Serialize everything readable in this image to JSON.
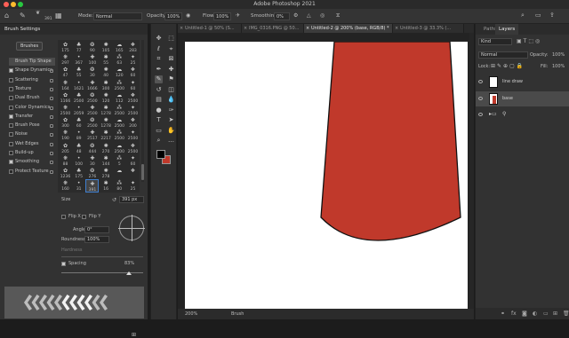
{
  "app": {
    "title": "Adobe Photoshop 2021"
  },
  "options_bar": {
    "size_value": "391",
    "mode_label": "Mode:",
    "mode_value": "Normal",
    "opacity_label": "Opacity:",
    "opacity_value": "100%",
    "flow_label": "Flow:",
    "flow_value": "100%",
    "smoothing_label": "Smoothing:",
    "smoothing_value": "0%"
  },
  "brush_panel": {
    "title": "Brush Settings",
    "brushes_button": "Brushes",
    "options": [
      {
        "label": "Brush Tip Shape",
        "checked": false,
        "selected": true,
        "lock": false
      },
      {
        "label": "Shape Dynamics",
        "checked": true,
        "lock": true
      },
      {
        "label": "Scattering",
        "checked": false,
        "lock": true
      },
      {
        "label": "Texture",
        "checked": false,
        "lock": true
      },
      {
        "label": "Dual Brush",
        "checked": false,
        "lock": true
      },
      {
        "label": "Color Dynamics",
        "checked": false,
        "lock": true
      },
      {
        "label": "Transfer",
        "checked": true,
        "lock": true
      },
      {
        "label": "Brush Pose",
        "checked": false,
        "lock": true
      },
      {
        "label": "Noise",
        "checked": false,
        "lock": true
      },
      {
        "label": "Wet Edges",
        "checked": false,
        "lock": true
      },
      {
        "label": "Build-up",
        "checked": false,
        "lock": true
      },
      {
        "label": "Smoothing",
        "checked": true,
        "lock": true
      },
      {
        "label": "Protect Texture",
        "checked": false,
        "lock": true
      }
    ],
    "tips": [
      "175",
      "77",
      "90",
      "105",
      "165",
      "283",
      "297",
      "367",
      "100",
      "55",
      "63",
      "25",
      "47",
      "55",
      "30",
      "40",
      "120",
      "60",
      "164",
      "1621",
      "1666",
      "300",
      "2500",
      "60",
      "1166",
      "2500",
      "2500",
      "120",
      "112",
      "2500",
      "2500",
      "2059",
      "2500",
      "1278",
      "2500",
      "2500",
      "300",
      "60",
      "2500",
      "1278",
      "2500",
      "200",
      "190",
      "89",
      "2517",
      "2217",
      "2500",
      "2500",
      "205",
      "48",
      "444",
      "270",
      "2500",
      "2500",
      "88",
      "100",
      "30",
      "144",
      "5",
      "60",
      "1236",
      "175",
      "276",
      "278",
      "",
      "",
      "160",
      "31",
      "391",
      "16",
      "80",
      "25"
    ],
    "selected_tip_index": 68,
    "size_label": "Size",
    "size_value": "391 px",
    "flip_x": "Flip X",
    "flip_y": "Flip Y",
    "angle_label": "Angle:",
    "angle_value": "0°",
    "roundness_label": "Roundness:",
    "roundness_value": "100%",
    "hardness_label": "Hardness",
    "spacing_label": "Spacing",
    "spacing_value": "83%",
    "spacing_fraction": 0.83
  },
  "tabs": [
    {
      "label": "Untitled-1 @ 50% (S..."
    },
    {
      "label": "IMG_0316.PNG @ 50..."
    },
    {
      "label": "Untitled-2 @ 200% (base, RGB/8) *"
    },
    {
      "label": "Untitled-3 @ 33.3% (..."
    }
  ],
  "status": {
    "zoom": "200%",
    "tool": "Brush"
  },
  "layers_panel": {
    "tabs": [
      "Paths",
      "Layers"
    ],
    "search_label": "Kind",
    "blend_mode": "Normal",
    "opacity_label": "Opacity:",
    "opacity_value": "100%",
    "lock_label": "Lock:",
    "fill_label": "Fill:",
    "fill_value": "100%",
    "layers": [
      {
        "name": "line draw"
      },
      {
        "name": "base"
      }
    ]
  },
  "colors": {
    "shape_fill": "#c0392b",
    "foreground": "#000000",
    "background": "#c0392b"
  }
}
